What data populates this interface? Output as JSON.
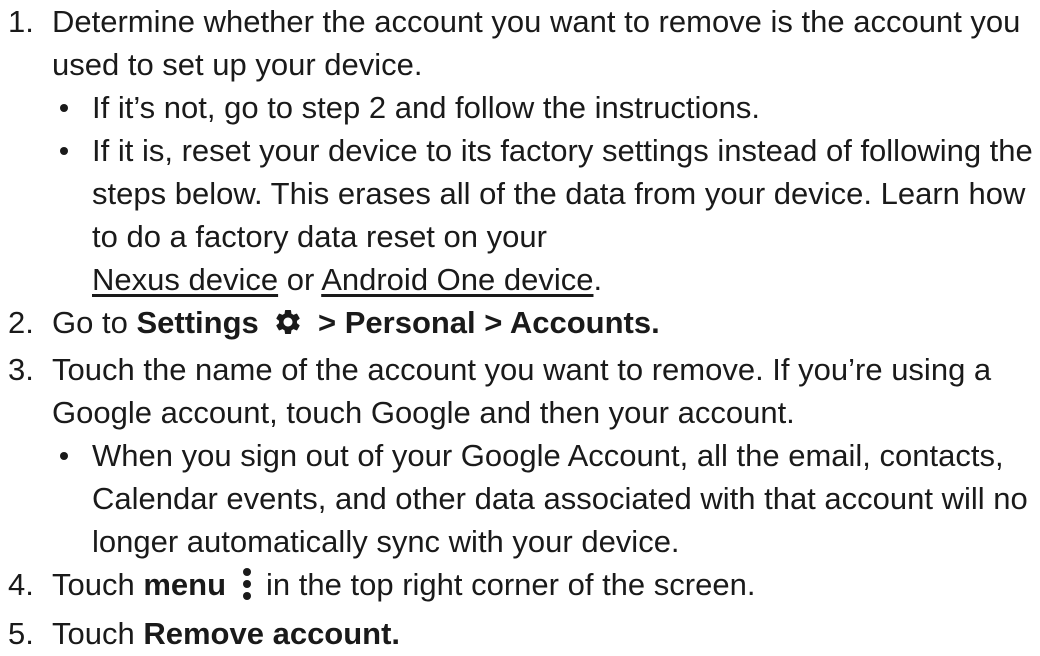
{
  "steps": [
    {
      "num": "1.",
      "text": "Determine whether the account you want to remove is the account you used to set up your device.",
      "sub": [
        "If it’s not, go to step 2 and follow the instructions.",
        {
          "text": "If it is, reset your device to its factory settings instead of following the steps below. This erases all of the data from your device. Learn how to do a factory data reset on your",
          "link1": "Nexus device",
          "or": "or",
          "link2": "Android One device",
          "end": "."
        }
      ]
    },
    {
      "num": "2.",
      "prefix": "Go to",
      "settings": "Settings",
      "path": "> Personal > Accounts.",
      "icon": "gear-icon"
    },
    {
      "num": "3.",
      "text": "Touch the name of the account you want to remove. If you’re using a Google account, touch Google and then your account.",
      "sub": [
        "When you sign out of your Google Account, all the email, contacts, Calendar events, and other data associated with that account will no longer automatically sync with your device."
      ]
    },
    {
      "num": "4.",
      "prefix": "Touch",
      "menu": "menu",
      "suffix": "in the top right corner of the screen.",
      "icon": "more-vertical-icon"
    },
    {
      "num": "5.",
      "prefix": "Touch",
      "action": "Remove account."
    }
  ]
}
